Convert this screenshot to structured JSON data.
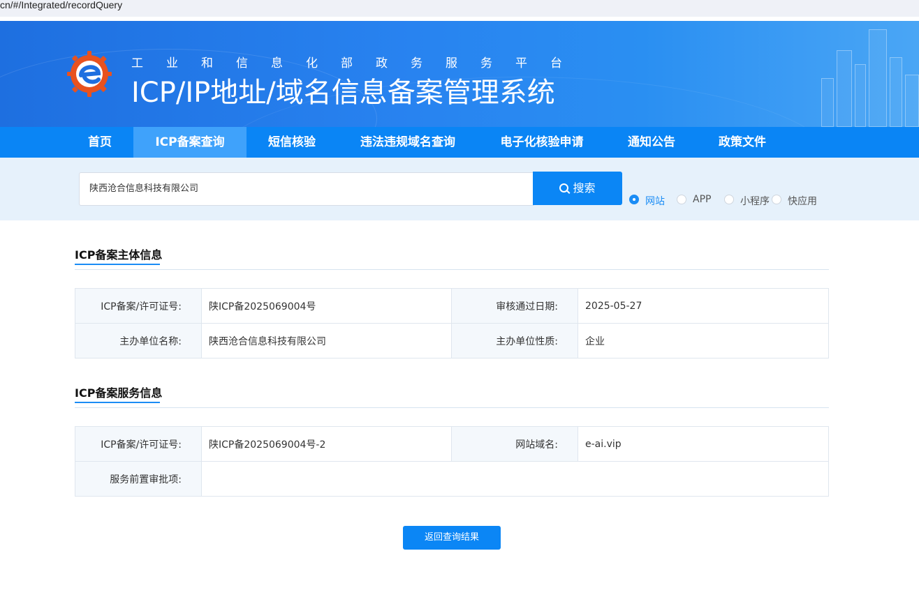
{
  "browser": {
    "url": "cn/#/Integrated/recordQuery"
  },
  "header": {
    "subtitle_chars": [
      "工",
      "业",
      "和",
      "信",
      "息",
      "化",
      "部",
      "政",
      "务",
      "服",
      "务",
      "平",
      "台"
    ],
    "title": "ICP/IP地址/域名信息备案管理系统"
  },
  "nav": {
    "items": [
      {
        "label": "首页"
      },
      {
        "label": "ICP备案查询"
      },
      {
        "label": "短信核验"
      },
      {
        "label": "违法违规域名查询"
      },
      {
        "label": "电子化核验申请"
      },
      {
        "label": "通知公告"
      },
      {
        "label": "政策文件"
      }
    ],
    "active": "ICP备案查询"
  },
  "search": {
    "value": "陕西沧合信息科技有限公司",
    "button_label": "搜索",
    "types": [
      {
        "label": "网站",
        "checked": true
      },
      {
        "label": "APP",
        "checked": false
      },
      {
        "label": "小程序",
        "checked": false
      },
      {
        "label": "快应用",
        "checked": false
      }
    ]
  },
  "subject": {
    "title": "ICP备案主体信息",
    "license_label": "ICP备案/许可证号:",
    "license_value": "陕ICP备2025069004号",
    "approve_date_label": "审核通过日期:",
    "approve_date_value": "2025-05-27",
    "org_name_label": "主办单位名称:",
    "org_name_value": "陕西沧合信息科技有限公司",
    "org_type_label": "主办单位性质:",
    "org_type_value": "企业"
  },
  "service": {
    "title": "ICP备案服务信息",
    "license_label": "ICP备案/许可证号:",
    "license_value": "陕ICP备2025069004号-2",
    "domain_label": "网站域名:",
    "domain_value": "e-ai.vip",
    "pre_approval_label": "服务前置审批项:",
    "pre_approval_value": ""
  },
  "back_button_label": "返回查询结果",
  "colors": {
    "primary": "#0b86f5",
    "nav_active": "#3fa2fb",
    "search_bg": "#e6f1fb"
  }
}
